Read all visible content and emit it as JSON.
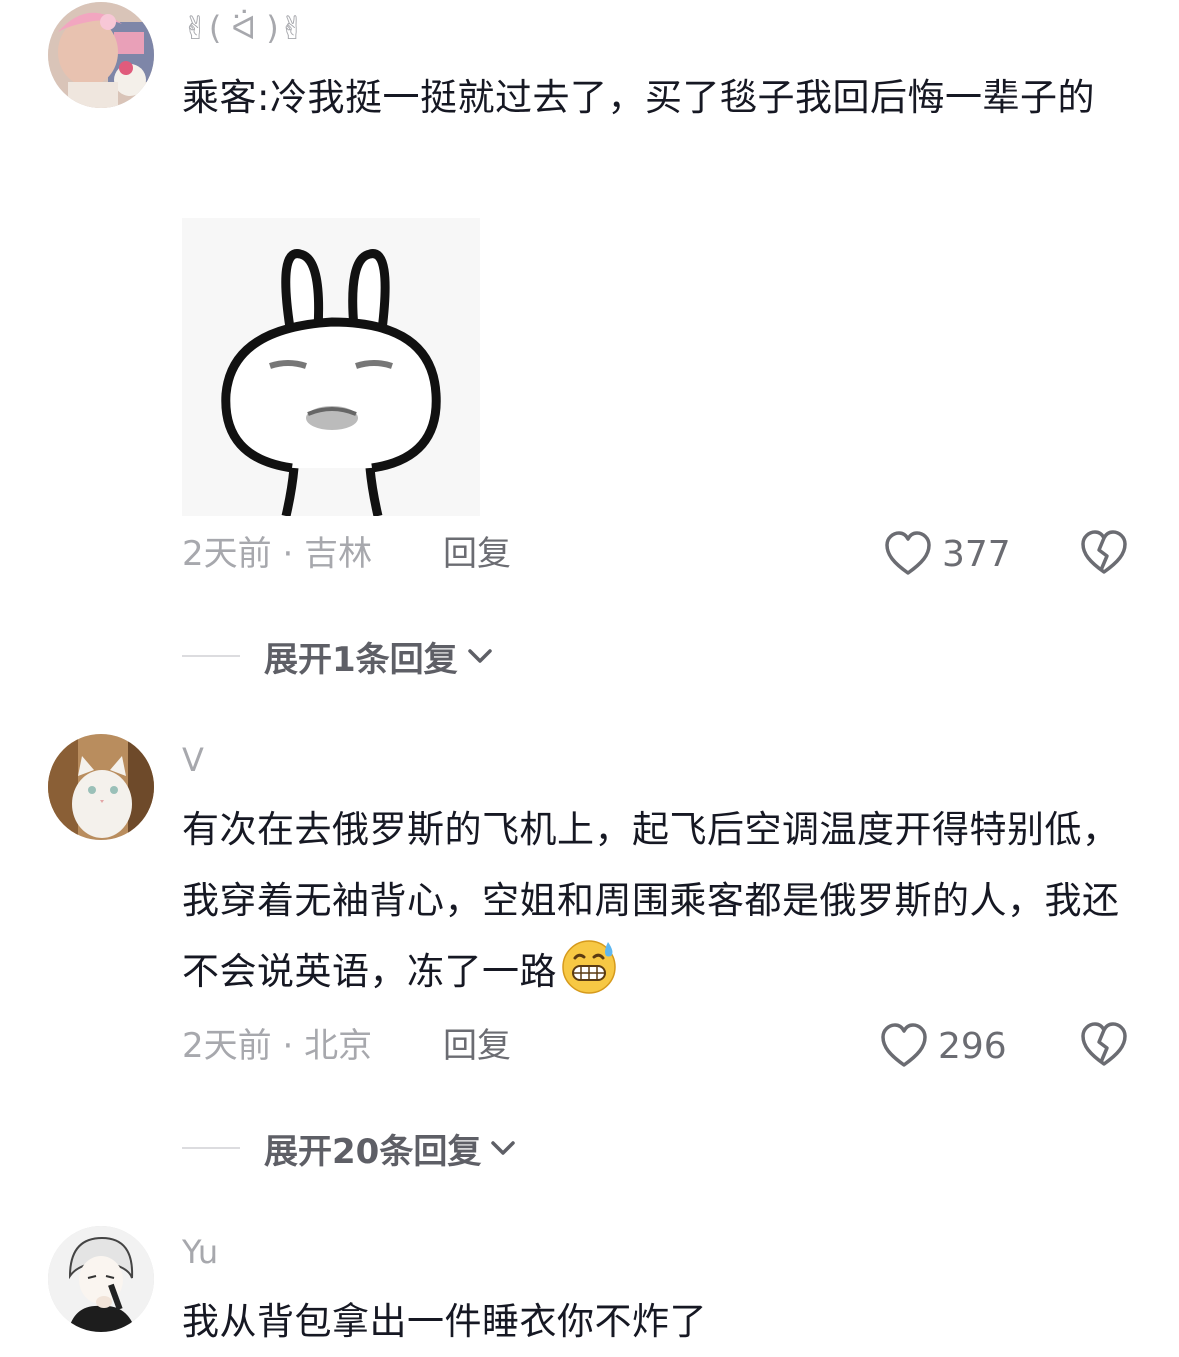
{
  "comments": [
    {
      "username": "✌( ᐛ )✌",
      "text": "乘客:冷我挺一挺就过去了，买了毯子我回后悔一辈子的",
      "time": "2天前",
      "location": "吉林",
      "reply_label": "回复",
      "likes": "377",
      "expand_label": "展开1条回复"
    },
    {
      "username": "V",
      "text": "有次在去俄罗斯的飞机上，起飞后空调温度开得特别低，我穿着无袖背心，空姐和周围乘客都是俄罗斯的人，我还不会说英语，冻了一路",
      "emoji": "grinning-sweat-emoji",
      "time": "2天前",
      "location": "北京",
      "reply_label": "回复",
      "likes": "296",
      "expand_label": "展开20条回复"
    },
    {
      "username": "Yu",
      "text": "我从背包拿出一件睡衣你不炸了"
    }
  ],
  "separator": " · ",
  "colors": {
    "text": "#161823",
    "secondary": "#a7a8ad",
    "action": "#6b6c72"
  }
}
